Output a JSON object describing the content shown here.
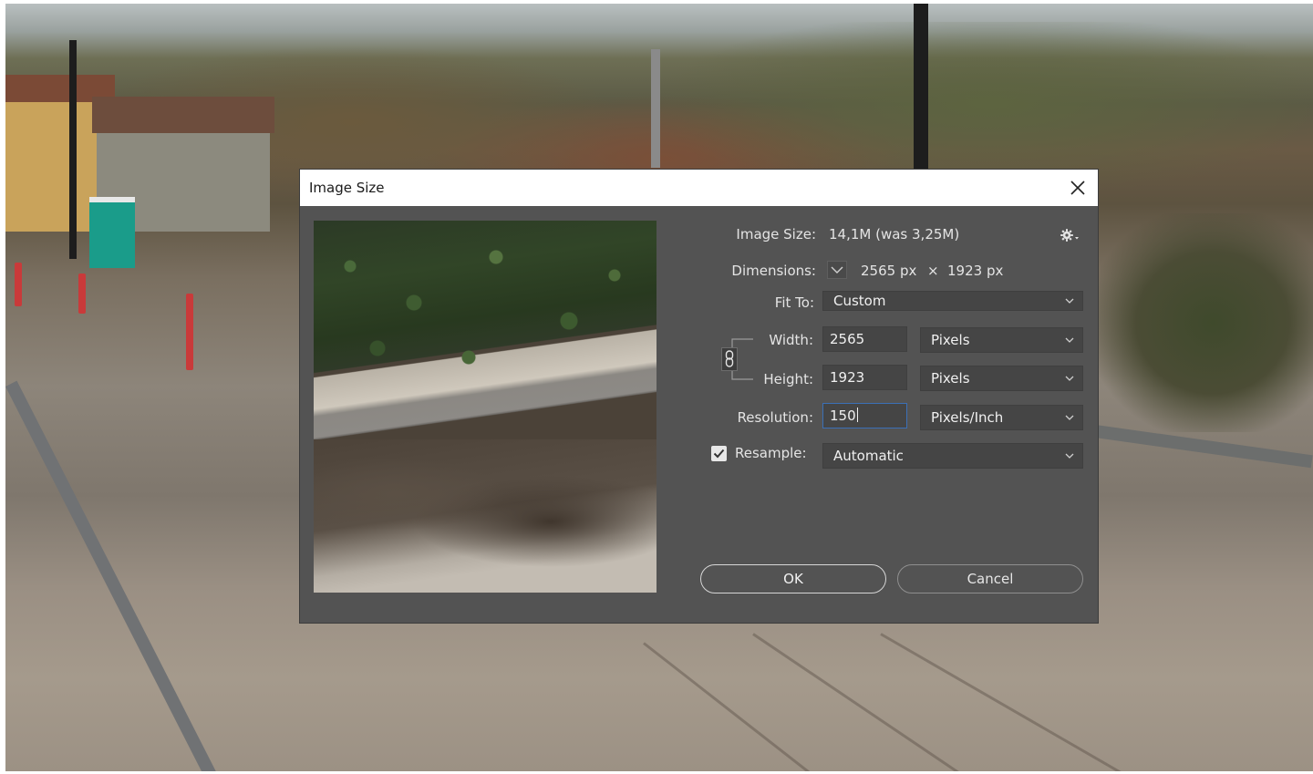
{
  "dialog": {
    "title": "Image Size",
    "close_glyph": "✕",
    "gear_glyph": "⚙",
    "image_size_label": "Image Size:",
    "image_size_value": "14,1M (was 3,25M)",
    "dimensions_label": "Dimensions:",
    "dimensions_width": "2565 px",
    "dimensions_times": "×",
    "dimensions_height": "1923 px",
    "fit_to_label": "Fit To:",
    "fit_to_value": "Custom",
    "width_label": "Width:",
    "width_value": "2565",
    "width_unit": "Pixels",
    "height_label": "Height:",
    "height_value": "1923",
    "height_unit": "Pixels",
    "resolution_label": "Resolution:",
    "resolution_value": "150",
    "resolution_unit": "Pixels/Inch",
    "resample_label": "Resample:",
    "resample_checked": true,
    "resample_value": "Automatic",
    "ok_label": "OK",
    "cancel_label": "Cancel"
  },
  "icons": {
    "close": "close-icon",
    "settings": "gear-icon",
    "dimensions_toggle": "chevron-down-icon",
    "constrain": "chain-link-icon",
    "checkbox": "checkmark-icon"
  },
  "colors": {
    "dialog_bg": "#535353",
    "titlebar_bg": "#ffffff",
    "field_bg": "#454545",
    "focus_border": "#3b6fb6",
    "text": "#e4e4e4"
  }
}
